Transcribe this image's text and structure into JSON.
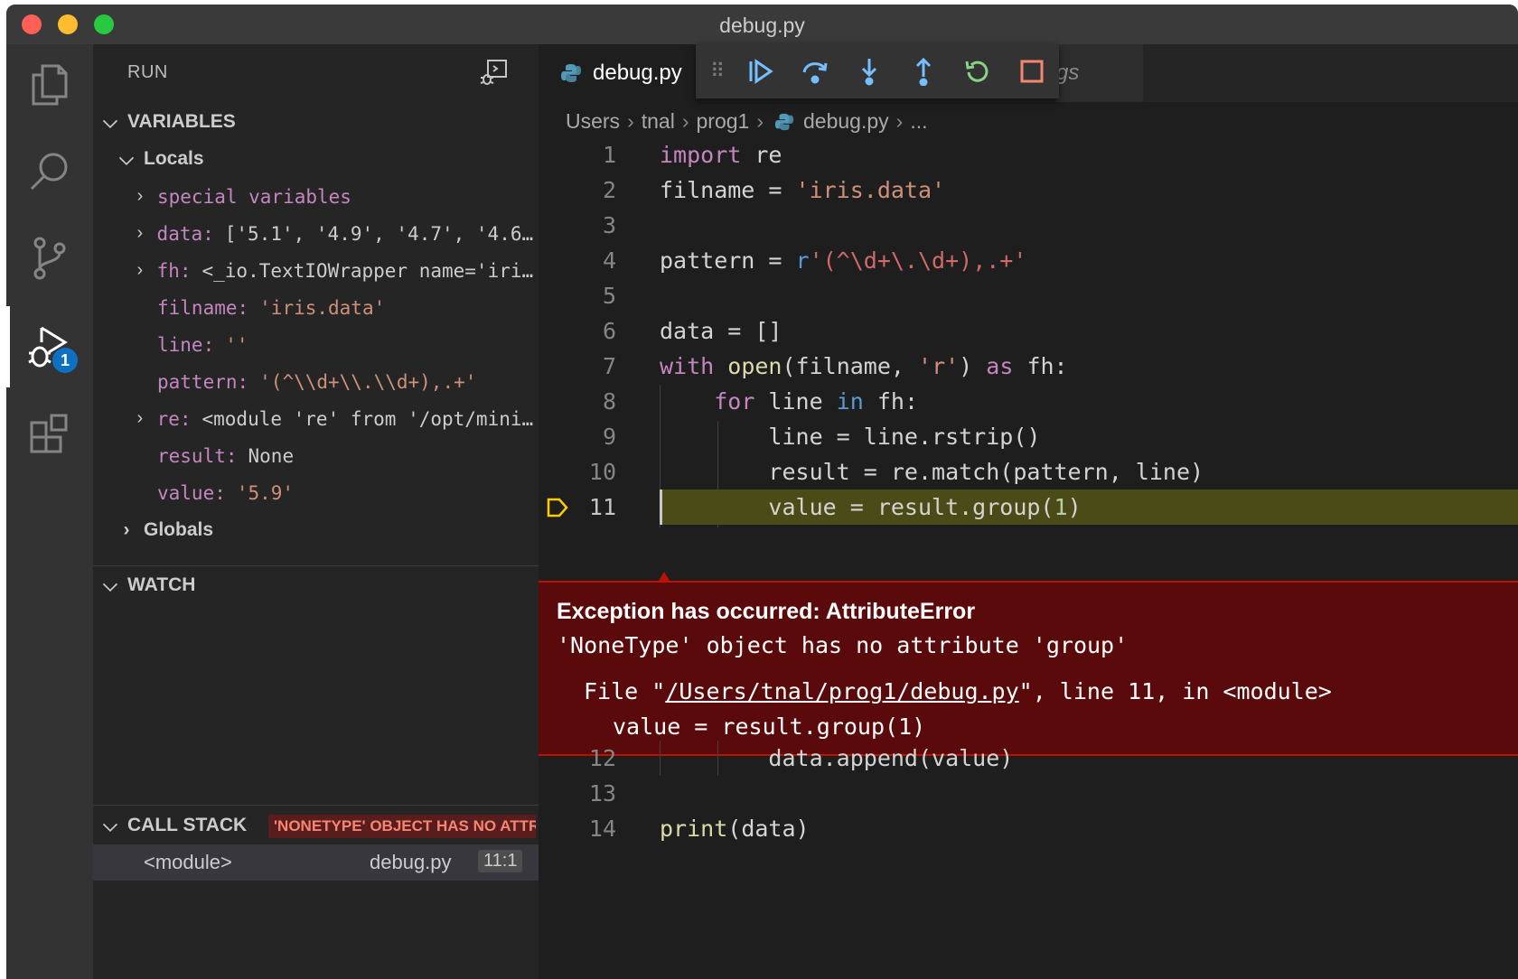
{
  "window": {
    "title": "debug.py"
  },
  "activity_bar": {
    "items": [
      {
        "icon": "files-icon",
        "active": false
      },
      {
        "icon": "search-icon",
        "active": false
      },
      {
        "icon": "source-control-icon",
        "active": false
      },
      {
        "icon": "run-debug-icon",
        "active": true,
        "badge": "1"
      },
      {
        "icon": "extensions-icon",
        "active": false
      }
    ]
  },
  "sidebar": {
    "title": "RUN",
    "variables": {
      "header": "VARIABLES",
      "locals_label": "Locals",
      "items": [
        {
          "name": "special variables",
          "value": "",
          "expandable": true
        },
        {
          "name": "data:",
          "value": "['5.1', '4.9', '4.7', '4.6'…",
          "expandable": true
        },
        {
          "name": "fh:",
          "value": "<_io.TextIOWrapper name='iris…",
          "expandable": true
        },
        {
          "name": "filname:",
          "value": "'iris.data'",
          "expandable": false
        },
        {
          "name": "line:",
          "value": "''",
          "expandable": false
        },
        {
          "name": "pattern:",
          "value": "'(^\\\\d+\\\\.\\\\d+),.+'",
          "expandable": false
        },
        {
          "name": "re:",
          "value": "<module 're' from '/opt/minic…",
          "expandable": true
        },
        {
          "name": "result:",
          "value": "None",
          "expandable": false
        },
        {
          "name": "value:",
          "value": "'5.9'",
          "expandable": false
        }
      ],
      "globals_label": "Globals"
    },
    "watch": {
      "header": "WATCH"
    },
    "call_stack": {
      "header": "CALL STACK",
      "error_badge": "'NONETYPE' OBJECT HAS NO ATTRIBUTE 'GROUP'",
      "frames": [
        {
          "name": "<module>",
          "file": "debug.py",
          "position": "11:1"
        }
      ]
    }
  },
  "editor": {
    "tab": {
      "label": "debug.py"
    },
    "tab2_partial": "gs",
    "debug_toolbar": {
      "buttons": [
        "continue",
        "step-over",
        "step-into",
        "step-out",
        "restart",
        "stop"
      ]
    },
    "breadcrumb": [
      "Users",
      "tnal",
      "prog1",
      "debug.py",
      "..."
    ],
    "current_line": 11,
    "code_lines": [
      {
        "n": "1",
        "text": "import re"
      },
      {
        "n": "2",
        "text": "filname = 'iris.data'"
      },
      {
        "n": "3",
        "text": ""
      },
      {
        "n": "4",
        "text": "pattern = r'(^\\d+\\.\\d+),.+'"
      },
      {
        "n": "5",
        "text": ""
      },
      {
        "n": "6",
        "text": "data = []"
      },
      {
        "n": "7",
        "text": "with open(filname, 'r') as fh:"
      },
      {
        "n": "8",
        "text": "    for line in fh:"
      },
      {
        "n": "9",
        "text": "        line = line.rstrip()"
      },
      {
        "n": "10",
        "text": "        result = re.match(pattern, line)"
      },
      {
        "n": "11",
        "text": "        value = result.group(1)"
      },
      {
        "n": "12",
        "text": "        data.append(value)"
      },
      {
        "n": "13",
        "text": ""
      },
      {
        "n": "14",
        "text": "print(data)"
      }
    ],
    "exception": {
      "title": "Exception has occurred: AttributeError",
      "message": "'NoneType' object has no attribute 'group'",
      "file_prefix": "File \"",
      "file_link": "/Users/tnal/prog1/debug.py",
      "file_suffix": "\", line 11, in <module>",
      "code": "value = result.group(1)"
    }
  },
  "colors": {
    "error_red": "#be1100",
    "exception_bg": "#5a0a0a",
    "current_line_bg": "#4b4b18",
    "badge_blue": "#0e70c0",
    "breakpoint_arrow": "#ffcc00"
  }
}
